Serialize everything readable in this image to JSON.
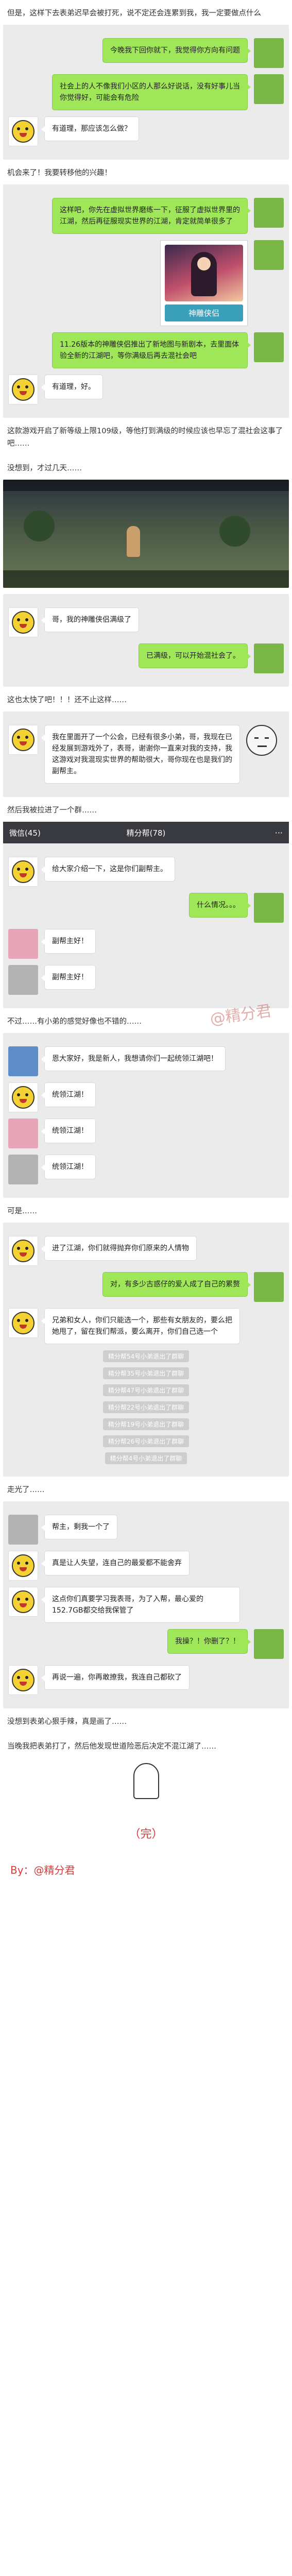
{
  "narration": {
    "n1": "但是，这样下去表弟迟早会被打死，说不定还会连累到我，我一定要做点什么",
    "n2": "机会来了！我要转移他的兴趣！",
    "n3": "这款游戏开启了新等级上限109级，等他打到满级的时候应该也早忘了混社会这事了吧……",
    "n4": "没想到，才过几天……",
    "n5": "这也太快了吧！！！还不止这样……",
    "n6": "然后我被拉进了一个群……",
    "n7": "不过……有小弟的感觉好像也不错的……",
    "n8": "可是……",
    "n9": "走光了……",
    "n10": "没想到表弟心狠手辣，真是画了……",
    "n11": "当晚我把表弟打了，然后他发现世道险恶后决定不混江湖了……"
  },
  "chat1": [
    {
      "side": "right",
      "text": "今晚我下回你就下，我觉得你方向有问题"
    },
    {
      "side": "right",
      "text": "社会上的人不像我们小区的人那么好说话，没有好事儿当你觉得好，可能会有危险"
    },
    {
      "side": "left",
      "text": "有道理，那应该怎么做？"
    }
  ],
  "chat2": [
    {
      "side": "right",
      "text": "这样吧，你先在虚拟世界磨练一下，征服了虚拟世界里的江湖，然后再征服现实世界的江湖，肯定就简单很多了"
    },
    {
      "side": "right",
      "text": "11.26版本的神雕侠侣推出了新地图与新剧本，去里面体验全新的江湖吧，等你满级后再去混社会吧"
    },
    {
      "side": "left",
      "text": "有道理，好。"
    }
  ],
  "game_card": {
    "caption": "神雕侠侣"
  },
  "chat3": [
    {
      "side": "left",
      "text": "哥，我的神雕侠侣满级了"
    },
    {
      "side": "right",
      "text": "已满级，可以开始混社会了。"
    }
  ],
  "chat4": [
    {
      "side": "left",
      "text": "我在里面开了一个公会，已经有很多小弟，哥，我现在已经发展到游戏外了，表哥，谢谢你一直来对我的支持，我这游戏对我混现实世界的帮助很大，哥你现在也是我们的副帮主。"
    }
  ],
  "group_bar": {
    "back": "微信(45)",
    "title": "精分帮(78)",
    "more": "···"
  },
  "group_chat": [
    {
      "side": "left",
      "avatar": "pig",
      "text": "给大家介绍一下，这是你们副帮主。"
    },
    {
      "side": "right",
      "avatar": "pig",
      "text": "什么情况。。。"
    },
    {
      "side": "left",
      "avatar": "pink",
      "text": "副帮主好！"
    },
    {
      "side": "left",
      "avatar": "gray",
      "text": "副帮主好！"
    }
  ],
  "watermark": "@精分君",
  "chat5": [
    {
      "side": "left",
      "avatar": "blue",
      "text": "恩大家好，我是新人，我想请你们一起统领江湖吧！"
    },
    {
      "side": "left",
      "avatar": "pig",
      "text": "统领江湖！"
    },
    {
      "side": "left",
      "avatar": "pink",
      "text": "统领江湖！"
    },
    {
      "side": "left",
      "avatar": "gray",
      "text": "统领江湖！"
    }
  ],
  "chat6": [
    {
      "side": "left",
      "text": "进了江湖，你们就得抛弃你们原来的人情物"
    },
    {
      "side": "right",
      "text": "对，有多少古惑仔的爱人成了自己的累赘"
    },
    {
      "side": "left",
      "text": "兄弟和女人，你们只能选一个，那些有女朋友的，要么把她甩了，留在我们帮派，要么离开，你们自己选一个"
    }
  ],
  "sys_msgs": [
    "精分帮54号小弟退出了群聊",
    "精分帮35号小弟退出了群聊",
    "精分帮47号小弟退出了群聊",
    "精分帮22号小弟退出了群聊",
    "精分帮19号小弟退出了群聊",
    "精分帮26号小弟退出了群聊",
    "精分帮4号小弟退出了群聊"
  ],
  "chat7": [
    {
      "side": "left",
      "avatar": "gray",
      "text": "帮主，剩我一个了"
    },
    {
      "side": "left",
      "text": "真是让人失望，连自己的最爱都不能舍弃"
    },
    {
      "side": "left",
      "text": "这点你们真要学习我表哥，为了入帮，最心爱的152.7GB都交给我保管了"
    },
    {
      "side": "right",
      "text": "我操？！你删了？！"
    },
    {
      "side": "left",
      "text": "再说一遍，你再敢撩我，我连自己都砍了"
    }
  ],
  "end": "（完）",
  "byline": "By：@精分君"
}
